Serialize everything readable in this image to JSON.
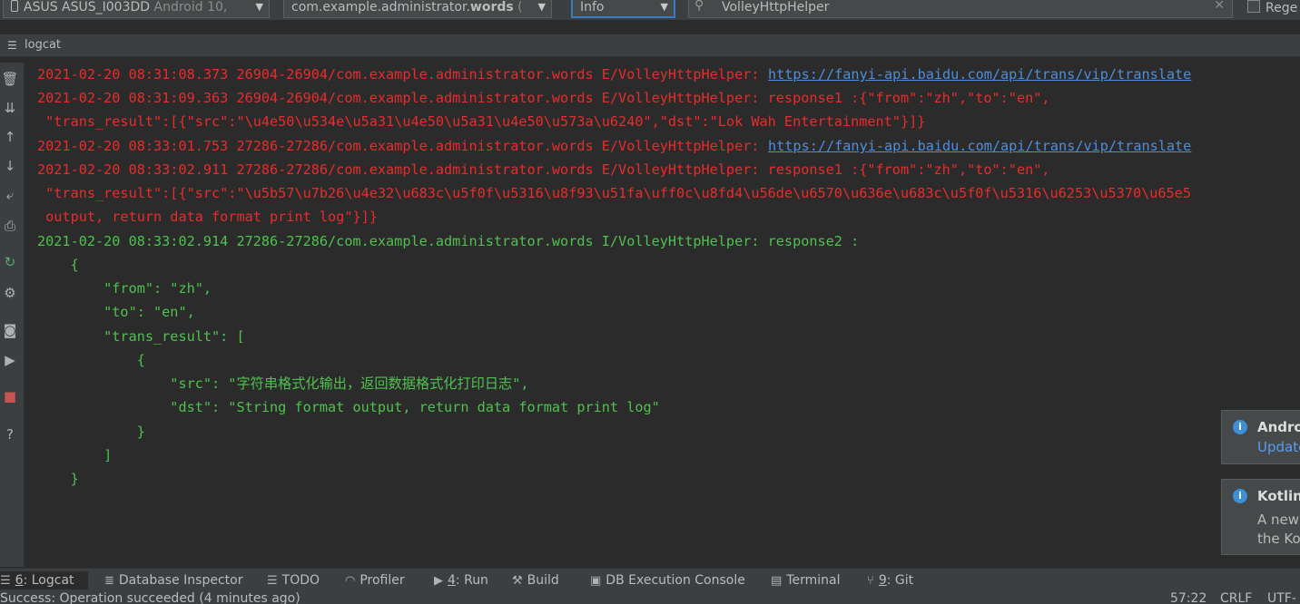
{
  "toolbar": {
    "device": "ASUS ASUS_I003DD",
    "device_os": "Android 10,",
    "process_prefix": "com.example.administrator.",
    "process_bold": "words",
    "process_suffix": " (",
    "level": "Info",
    "search_value": "VolleyHttpHelper",
    "regex_label": "Rege"
  },
  "panel": {
    "title": "logcat"
  },
  "log": {
    "lines": [
      {
        "kind": "err",
        "text": "2021-02-20 08:31:08.373 26904-26904/com.example.administrator.words E/VolleyHttpHelper: ",
        "link": "https://fanyi-api.baidu.com/api/trans/vip/translate"
      },
      {
        "kind": "err",
        "text": "2021-02-20 08:31:09.363 26904-26904/com.example.administrator.words E/VolleyHttpHelper: response1 :{\"from\":\"zh\",\"to\":\"en\","
      },
      {
        "kind": "err",
        "text": " \"trans_result\":[{\"src\":\"\\u4e50\\u534e\\u5a31\\u4e50\\u5a31\\u4e50\\u573a\\u6240\",\"dst\":\"Lok Wah Entertainment\"}]}"
      },
      {
        "kind": "err",
        "text": "2021-02-20 08:33:01.753 27286-27286/com.example.administrator.words E/VolleyHttpHelper: ",
        "link": "https://fanyi-api.baidu.com/api/trans/vip/translate"
      },
      {
        "kind": "err",
        "text": "2021-02-20 08:33:02.911 27286-27286/com.example.administrator.words E/VolleyHttpHelper: response1 :{\"from\":\"zh\",\"to\":\"en\","
      },
      {
        "kind": "err",
        "text": " \"trans_result\":[{\"src\":\"\\u5b57\\u7b26\\u4e32\\u683c\\u5f0f\\u5316\\u8f93\\u51fa\\uff0c\\u8fd4\\u56de\\u6570\\u636e\\u683c\\u5f0f\\u5316\\u6253\\u5370\\u65e5"
      },
      {
        "kind": "err",
        "text": " output, return data format print log\"}]}"
      },
      {
        "kind": "info",
        "text": "2021-02-20 08:33:02.914 27286-27286/com.example.administrator.words I/VolleyHttpHelper: response2 :"
      },
      {
        "kind": "info",
        "text": "    {"
      },
      {
        "kind": "info",
        "text": "        \"from\": \"zh\","
      },
      {
        "kind": "info",
        "text": "        \"to\": \"en\","
      },
      {
        "kind": "info",
        "text": "        \"trans_result\": ["
      },
      {
        "kind": "info",
        "text": "            {"
      },
      {
        "kind": "info",
        "text": "                \"src\": \"字符串格式化输出，返回数据格式化打印日志\","
      },
      {
        "kind": "info",
        "text": "                \"dst\": \"String format output, return data format print log\""
      },
      {
        "kind": "info",
        "text": "            }"
      },
      {
        "kind": "info",
        "text": "        ]"
      },
      {
        "kind": "info",
        "text": "    }"
      }
    ]
  },
  "notifications": [
    {
      "title": "Andro",
      "link": "Update"
    },
    {
      "title": "Kotlin",
      "body1": "A new",
      "body2": "the Ko"
    }
  ],
  "bottom_tabs": [
    {
      "mnemonic": "6",
      "label": ": Logcat"
    },
    {
      "mnemonic": "",
      "label": "Database Inspector"
    },
    {
      "mnemonic": "",
      "label": "TODO"
    },
    {
      "mnemonic": "",
      "label": "Profiler"
    },
    {
      "mnemonic": "4",
      "label": ": Run"
    },
    {
      "mnemonic": "",
      "label": "Build"
    },
    {
      "mnemonic": "",
      "label": "DB Execution Console"
    },
    {
      "mnemonic": "",
      "label": "Terminal"
    },
    {
      "mnemonic": "9",
      "label": ": Git"
    }
  ],
  "status": {
    "message": "Success: Operation succeeded (4 minutes ago)",
    "position": "57:22",
    "line_ending": "CRLF",
    "encoding": "UTF-"
  },
  "colors": {
    "error": "#e82c2c",
    "info": "#4fc14f",
    "link": "#4c8fdc"
  }
}
